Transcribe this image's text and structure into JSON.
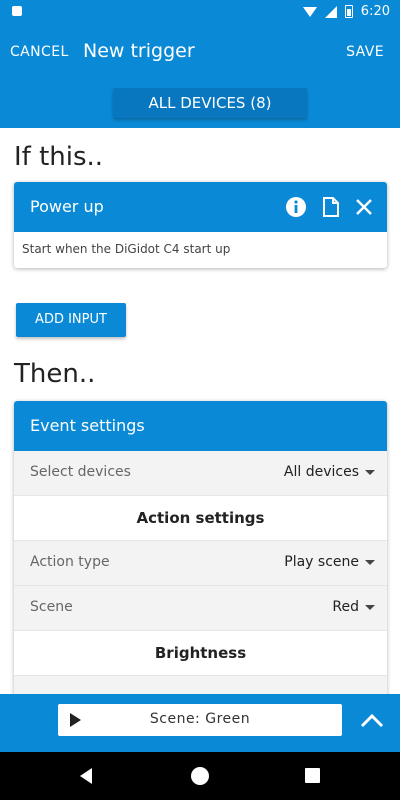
{
  "status_bar": {
    "time": "6:20"
  },
  "app_bar": {
    "cancel_label": "CANCEL",
    "title": "New trigger",
    "save_label": "SAVE",
    "devices_button": "ALL DEVICES (8)"
  },
  "if_section": {
    "heading": "If this..",
    "trigger_card": {
      "title": "Power up",
      "description": "Start when the DiGidot C4 start up"
    },
    "add_input_label": "ADD INPUT"
  },
  "then_section": {
    "heading": "Then..",
    "event_card": {
      "title": "Event settings",
      "select_devices": {
        "label": "Select devices",
        "value": "All devices"
      },
      "action_settings_title": "Action settings",
      "action_type": {
        "label": "Action type",
        "value": "Play scene"
      },
      "scene": {
        "label": "Scene",
        "value": "Red"
      },
      "brightness_title": "Brightness"
    }
  },
  "player_bar": {
    "scene_text": "Scene: Green"
  },
  "colors": {
    "primary": "#0a8ad6",
    "primary_dark": "#0877bf"
  }
}
